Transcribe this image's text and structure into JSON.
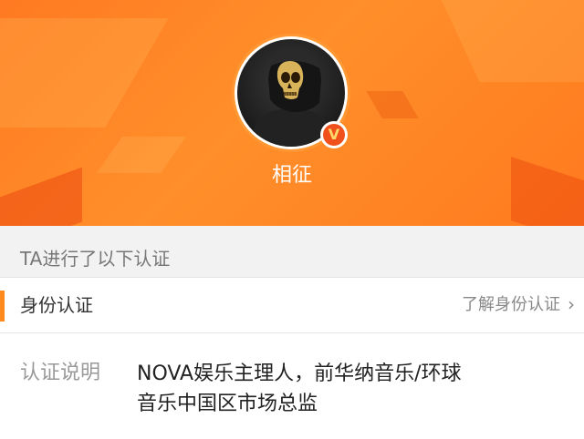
{
  "profile": {
    "username": "相征",
    "verified_mark": "V"
  },
  "verification": {
    "section_title": "TA进行了以下认证",
    "identity_title": "身份认证",
    "learn_more": "了解身份认证",
    "chevron": "›",
    "desc_label": "认证说明",
    "desc_line1": "NOVA娱乐主理人，前华纳音乐/环球",
    "desc_line2": "音乐中国区市场总监"
  },
  "colors": {
    "header_orange": "#ff8a25",
    "accent": "#ff8a1e",
    "badge_red": "#f0501c"
  },
  "icons": {
    "verified": "verified-badge-icon",
    "chevron": "chevron-right-icon"
  }
}
